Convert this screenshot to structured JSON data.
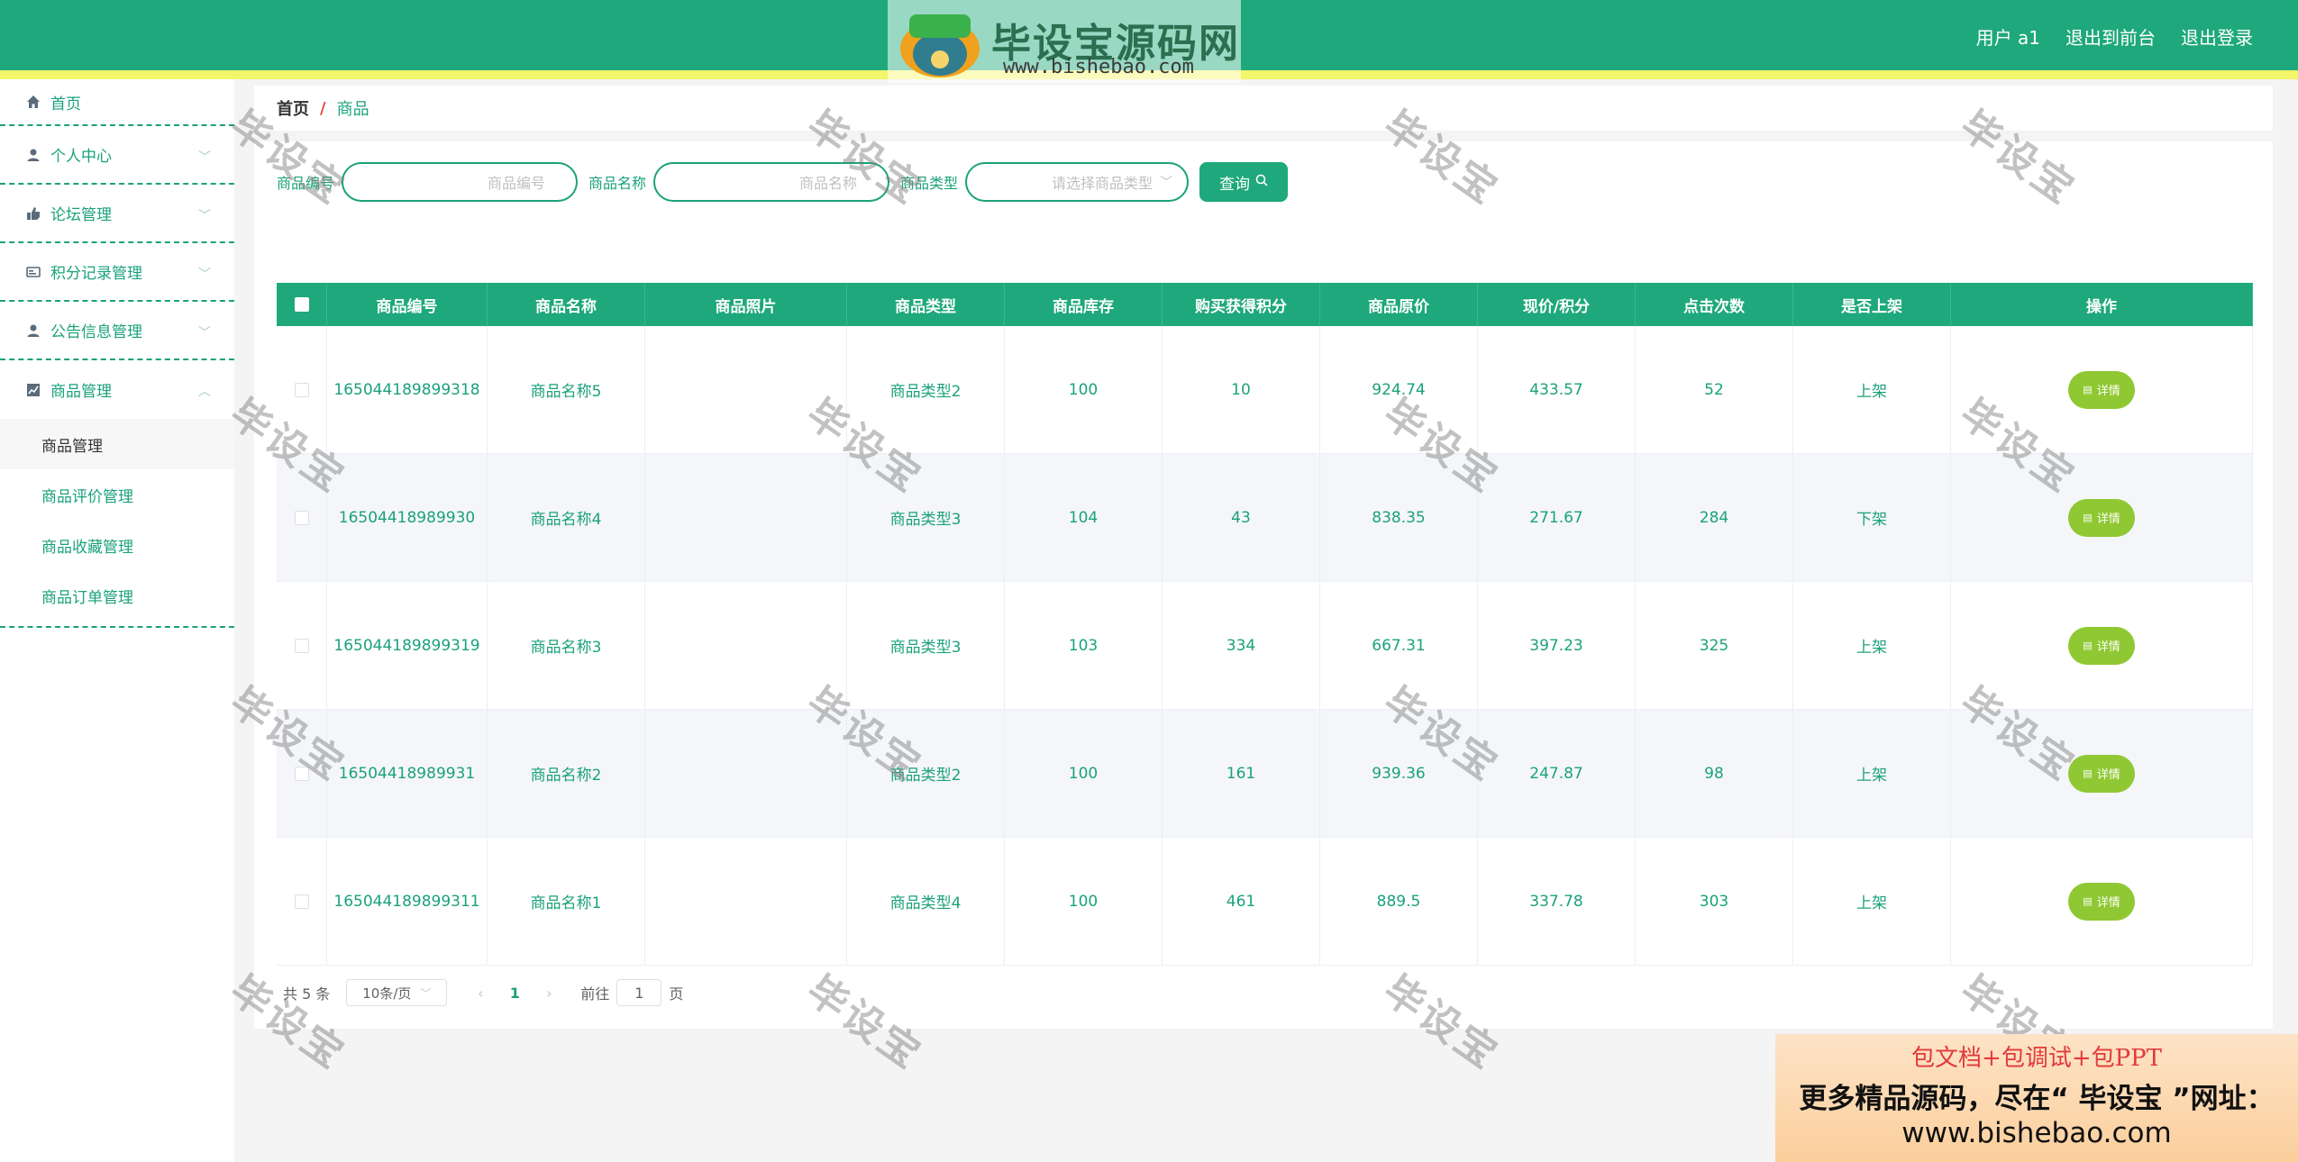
{
  "header": {
    "logo_badge_text": "毕设宝",
    "logo_title": "毕设宝源码网",
    "logo_url": "www.bishebao.com",
    "user_label": "用户 a1",
    "back_frontend": "退出到前台",
    "logout": "退出登录",
    "colors": {
      "primary": "#1ea87b",
      "stripe": "#f3f56a"
    }
  },
  "sidebar": {
    "items": [
      {
        "label": "首页",
        "icon": "home-icon"
      },
      {
        "label": "个人中心",
        "icon": "user-icon"
      },
      {
        "label": "论坛管理",
        "icon": "forum-icon"
      },
      {
        "label": "积分记录管理",
        "icon": "points-icon"
      },
      {
        "label": "公告信息管理",
        "icon": "notice-icon"
      },
      {
        "label": "商品管理",
        "icon": "chart-icon"
      }
    ],
    "subitems": [
      {
        "label": "商品管理"
      },
      {
        "label": "商品评价管理"
      },
      {
        "label": "商品收藏管理"
      },
      {
        "label": "商品订单管理"
      }
    ]
  },
  "breadcrumb": {
    "home": "首页",
    "sep": "/",
    "current": "商品"
  },
  "search": {
    "code_label": "商品编号",
    "code_placeholder": "商品编号",
    "name_label": "商品名称",
    "name_placeholder": "商品名称",
    "type_label": "商品类型",
    "type_placeholder": "请选择商品类型",
    "button": "查询"
  },
  "table": {
    "headers": [
      "商品编号",
      "商品名称",
      "商品照片",
      "商品类型",
      "商品库存",
      "购买获得积分",
      "商品原价",
      "现价/积分",
      "点击次数",
      "是否上架",
      "操作"
    ],
    "detail_label": "详情",
    "rows": [
      {
        "code": "165044189899318",
        "name": "商品名称5",
        "photo": "",
        "type": "商品类型2",
        "stock": "100",
        "points": "10",
        "orig_price": "924.74",
        "price": "433.57",
        "clicks": "52",
        "on_sale": "上架"
      },
      {
        "code": "16504418989930",
        "name": "商品名称4",
        "photo": "",
        "type": "商品类型3",
        "stock": "104",
        "points": "43",
        "orig_price": "838.35",
        "price": "271.67",
        "clicks": "284",
        "on_sale": "下架"
      },
      {
        "code": "165044189899319",
        "name": "商品名称3",
        "photo": "",
        "type": "商品类型3",
        "stock": "103",
        "points": "334",
        "orig_price": "667.31",
        "price": "397.23",
        "clicks": "325",
        "on_sale": "上架"
      },
      {
        "code": "16504418989931",
        "name": "商品名称2",
        "photo": "",
        "type": "商品类型2",
        "stock": "100",
        "points": "161",
        "orig_price": "939.36",
        "price": "247.87",
        "clicks": "98",
        "on_sale": "上架"
      },
      {
        "code": "165044189899311",
        "name": "商品名称1",
        "photo": "",
        "type": "商品类型4",
        "stock": "100",
        "points": "461",
        "orig_price": "889.5",
        "price": "337.78",
        "clicks": "303",
        "on_sale": "上架"
      }
    ]
  },
  "pagination": {
    "total": "共 5 条",
    "page_size": "10条/页",
    "current_page": "1",
    "goto_prefix": "前往",
    "goto_value": "1",
    "goto_suffix": "页"
  },
  "watermark": {
    "text": "毕设宝"
  },
  "promo": {
    "line1": "包文档+包调试+包PPT",
    "line2": "更多精品源码，尽在“ 毕设宝 ”网址：",
    "line3": "www.bishebao.com"
  }
}
